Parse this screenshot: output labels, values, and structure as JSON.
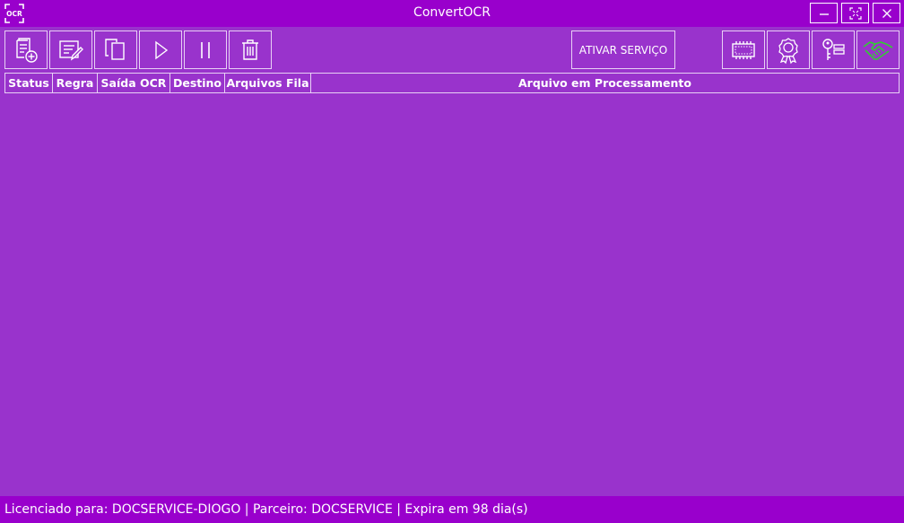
{
  "window": {
    "title": "ConvertOCR",
    "logo_text": "OCR",
    "controls": {
      "minimize": "minimize-icon",
      "maximize": "maximize-icon",
      "close": "close-icon"
    }
  },
  "toolbar": {
    "left_buttons": [
      "add-rule-icon",
      "edit-rule-icon",
      "copy-icon",
      "play-icon",
      "pause-icon",
      "delete-icon"
    ],
    "activate_label": "ATIVAR SERVIÇO",
    "right_buttons": [
      "memory-chip-icon",
      "award-ribbon-icon",
      "key-list-icon",
      "handshake-icon"
    ],
    "handshake_color": "#33cc33"
  },
  "grid": {
    "columns": [
      "Status",
      "Regra",
      "Saída OCR",
      "Destino",
      "Arquivos Fila",
      "Arquivo em Processamento"
    ],
    "rows": []
  },
  "statusbar": {
    "text": "Licenciado para: DOCSERVICE-DIOGO | Parceiro: DOCSERVICE | Expira em 98 dia(s)"
  },
  "colors": {
    "titlebar": "#9900cc",
    "body": "#9933cc"
  }
}
